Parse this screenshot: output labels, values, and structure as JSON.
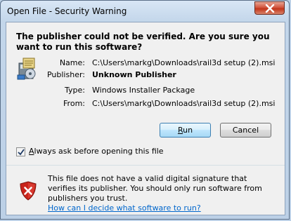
{
  "window": {
    "title": "Open File - Security Warning"
  },
  "dialog": {
    "headline": "The publisher could not be verified.  Are you sure you want to run this software?",
    "fields": [
      {
        "label": "Name:",
        "value": "C:\\Users\\markg\\Downloads\\rail3d setup (2).msi"
      },
      {
        "label": "Publisher:",
        "value": "Unknown Publisher"
      },
      {
        "label": "Type:",
        "value": "Windows Installer Package"
      },
      {
        "label": "From:",
        "value": "C:\\Users\\markg\\Downloads\\rail3d setup (2).msi"
      }
    ],
    "buttons": {
      "run_mnemonic": "R",
      "run_rest": "un",
      "cancel": "Cancel"
    },
    "checkbox": {
      "mnemonic": "A",
      "rest": "lways ask before opening this file",
      "checked": true
    },
    "footer": {
      "message": "This file does not have a valid digital signature that verifies its publisher.  You should only run software from publishers you trust.",
      "link": "How can I decide what software to run?"
    }
  },
  "colors": {
    "link": "#0066cc",
    "close_button": "#c2351a",
    "titlebar": "#bcd0e6"
  }
}
